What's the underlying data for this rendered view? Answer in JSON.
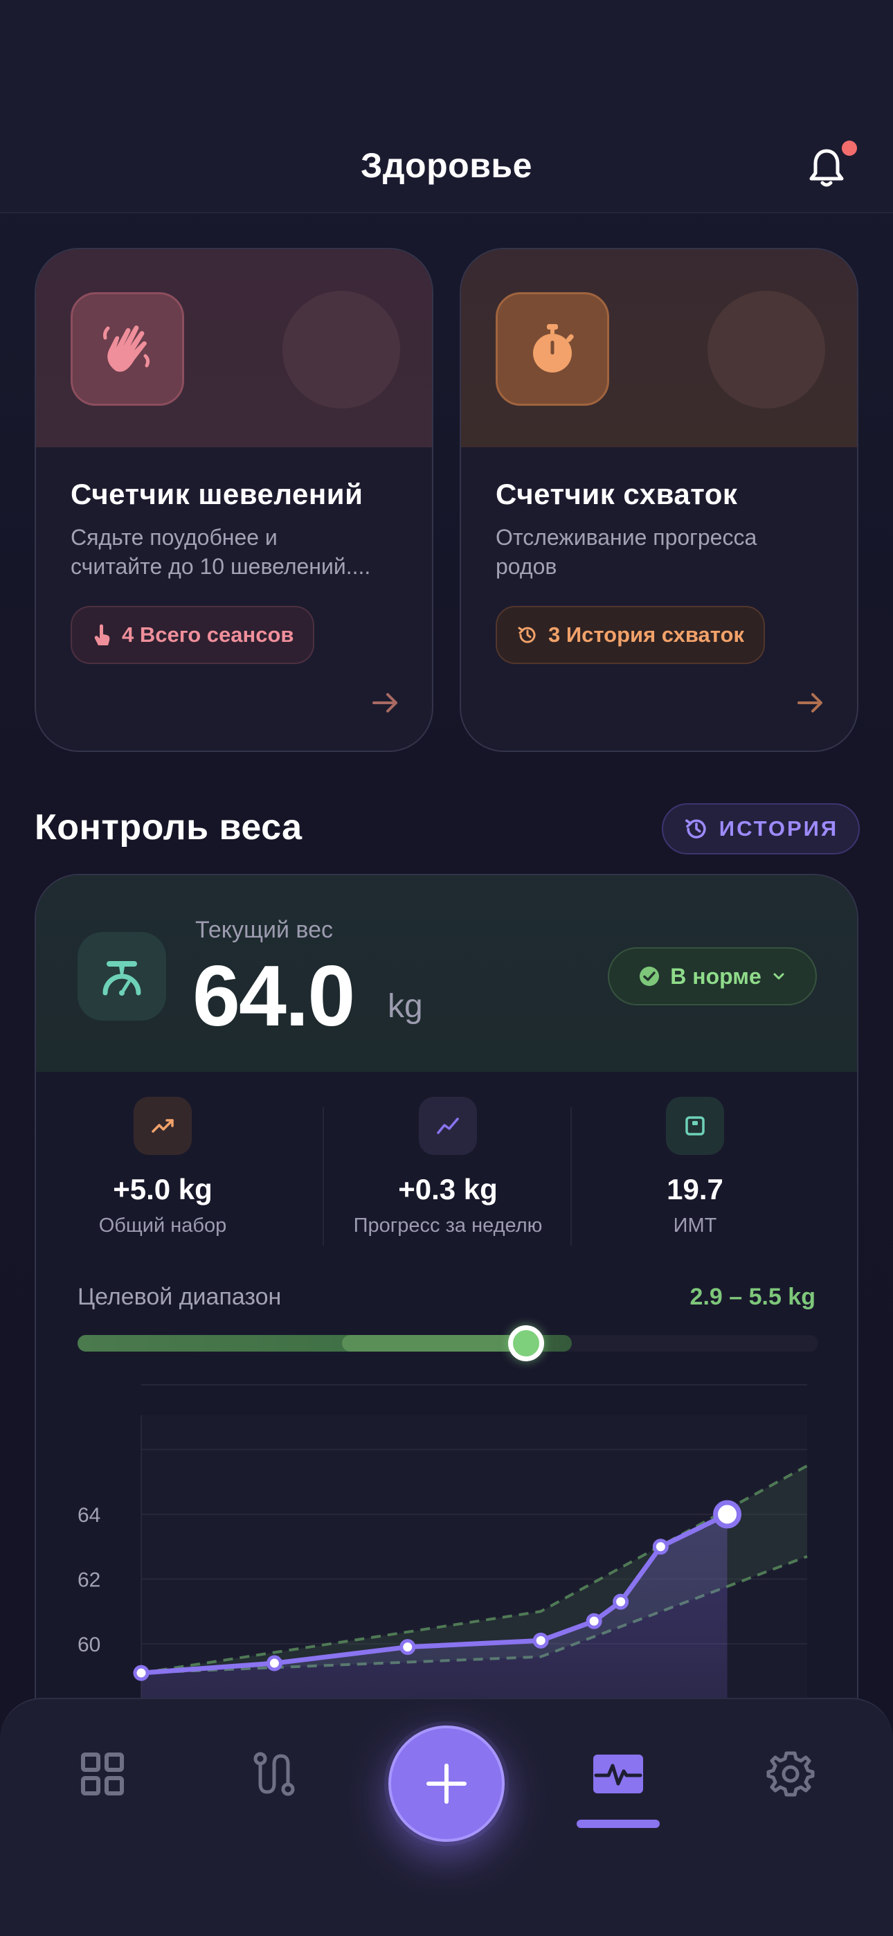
{
  "header": {
    "title": "Здоровье"
  },
  "cards": [
    {
      "title": "Счетчик шевелений",
      "desc_lines": [
        "Сядьте поудобнее и",
        "считайте до 10 шевелений...."
      ],
      "pill": "4 Всего сеансов",
      "icon": "waving-hand-icon",
      "accent": "#ef8f9b"
    },
    {
      "title": "Счетчик схваток",
      "desc_lines": [
        "Отслеживание прогресса",
        "родов"
      ],
      "pill": "3 История схваток",
      "icon": "stopwatch-icon",
      "accent": "#f2a26a"
    }
  ],
  "weight": {
    "section_title": "Контроль веса",
    "history_label": "ИСТОРИЯ",
    "current_label": "Текущий вес",
    "current_value": "64.0",
    "unit": "kg",
    "status": "В норме",
    "stats": [
      {
        "value": "+5.0 kg",
        "label": "Общий набор",
        "icon": "trending-up-icon",
        "color": "#f2a26a"
      },
      {
        "value": "+0.3 kg",
        "label": "Прогресс за неделю",
        "icon": "line-chart-icon",
        "color": "#8a74f0"
      },
      {
        "value": "19.7",
        "label": "ИМТ",
        "icon": "scale-square-icon",
        "color": "#6ed2b8"
      }
    ],
    "range_label": "Целевой диапазон",
    "range_value": "2.9 – 5.5 kg",
    "range_progress": 0.606
  },
  "chart_data": {
    "type": "line",
    "y_ticks": [
      "64",
      "62",
      "60"
    ],
    "ylim": [
      58,
      68
    ],
    "series": [
      {
        "values": [
          {
            "x": 0,
            "y": 59.1
          },
          {
            "x": 1,
            "y": 59.4
          },
          {
            "x": 2,
            "y": 59.9
          },
          {
            "x": 3,
            "y": 60.1
          },
          {
            "x": 3.4,
            "y": 60.7
          },
          {
            "x": 3.6,
            "y": 61.3
          },
          {
            "x": 3.9,
            "y": 63.0
          },
          {
            "x": 4.4,
            "y": 64.0
          }
        ]
      }
    ],
    "band_upper": [
      {
        "x": 0,
        "y": 59.1
      },
      {
        "x": 3,
        "y": 61.0
      },
      {
        "x": 5,
        "y": 65.5
      }
    ],
    "band_lower": [
      {
        "x": 0,
        "y": 59.1
      },
      {
        "x": 3,
        "y": 59.6
      },
      {
        "x": 5,
        "y": 62.7
      }
    ],
    "xlim": [
      0,
      5
    ],
    "line_color": "#8a74f0",
    "band_color": "#4f7a55"
  },
  "nav": {
    "items": [
      "dashboard-icon",
      "route-icon",
      "plus-icon",
      "activity-icon",
      "settings-icon"
    ],
    "active": "activity-icon",
    "accent": "#8a74f0"
  }
}
